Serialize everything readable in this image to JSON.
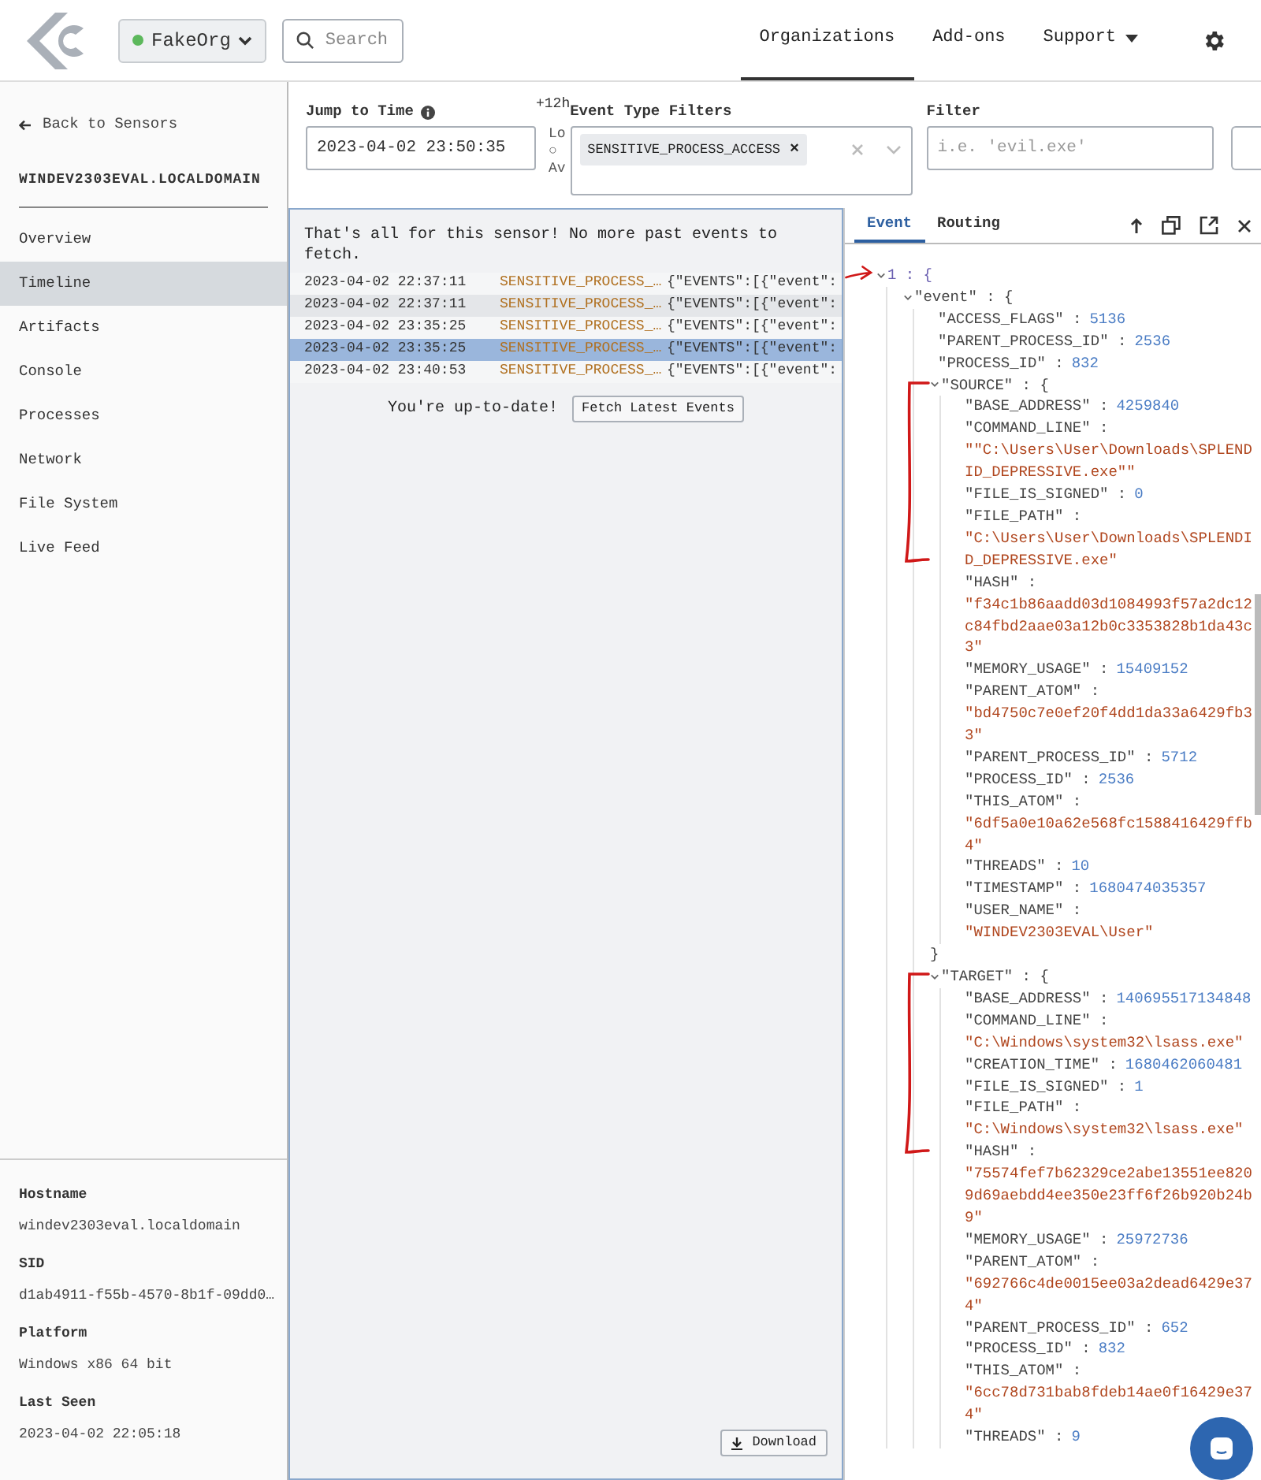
{
  "header": {
    "org": "FakeOrg",
    "search_placeholder": "Search",
    "links": [
      {
        "label": "Organizations",
        "selected": true,
        "dropdown": false
      },
      {
        "label": "Add-ons",
        "selected": false,
        "dropdown": false
      },
      {
        "label": "Support",
        "selected": false,
        "dropdown": true
      }
    ]
  },
  "sidebar": {
    "back": "Back to Sensors",
    "title": "WINDEV2303EVAL.LOCALDOMAIN",
    "items": [
      {
        "label": "Overview",
        "selected": false
      },
      {
        "label": "Timeline",
        "selected": true
      },
      {
        "label": "Artifacts",
        "selected": false
      },
      {
        "label": "Console",
        "selected": false
      },
      {
        "label": "Processes",
        "selected": false
      },
      {
        "label": "Network",
        "selected": false
      },
      {
        "label": "File System",
        "selected": false
      },
      {
        "label": "Live Feed",
        "selected": false
      }
    ],
    "info": [
      {
        "label": "Hostname",
        "value": "windev2303eval.localdomain"
      },
      {
        "label": "SID",
        "value": "d1ab4911-f55b-4570-8b1f-09dd0…"
      },
      {
        "label": "Platform",
        "value": "Windows x86 64 bit"
      },
      {
        "label": "Last Seen",
        "value": "2023-04-02 22:05:18"
      }
    ]
  },
  "filters": {
    "jump_label": "Jump to Time",
    "jump_value": "2023-04-02 23:50:35",
    "offset": "+12h",
    "fragments": [
      "Lo",
      "○",
      "Av"
    ],
    "event_type_label": "Event Type Filters",
    "tags": [
      {
        "label": "SENSITIVE_PROCESS_ACCESS",
        "remove": "×"
      }
    ],
    "filter_label": "Filter",
    "filter_placeholder": "i.e. 'evil.exe'"
  },
  "timeline": {
    "message": "That's all for this sensor! No more past events to fetch.",
    "rows": [
      {
        "time": "2023-04-02 22:37:11",
        "type": "SENSITIVE_PROCESS_…",
        "preview": "{\"EVENTS\":[{\"event\":",
        "selected": false
      },
      {
        "time": "2023-04-02 22:37:11",
        "type": "SENSITIVE_PROCESS_…",
        "preview": "{\"EVENTS\":[{\"event\":",
        "selected": false
      },
      {
        "time": "2023-04-02 23:35:25",
        "type": "SENSITIVE_PROCESS_…",
        "preview": "{\"EVENTS\":[{\"event\":",
        "selected": false
      },
      {
        "time": "2023-04-02 23:35:25",
        "type": "SENSITIVE_PROCESS_…",
        "preview": "{\"EVENTS\":[{\"event\":",
        "selected": true
      },
      {
        "time": "2023-04-02 23:40:53",
        "type": "SENSITIVE_PROCESS_…",
        "preview": "{\"EVENTS\":[{\"event\":",
        "selected": false
      }
    ],
    "status": "You're up-to-date!",
    "fetch_button": "Fetch Latest Events",
    "download": "Download"
  },
  "event_panel": {
    "tabs": [
      {
        "label": "Event",
        "selected": true
      },
      {
        "label": "Routing",
        "selected": false
      }
    ],
    "tree": [
      {
        "key": "1 : {",
        "expanded": true,
        "arrow_mark": true,
        "children": [
          {
            "key": "\"event\" : {",
            "expanded": true,
            "children": [
              {
                "key": "\"ACCESS_FLAGS\" :",
                "value": "5136",
                "kind": "number"
              },
              {
                "key": "\"PARENT_PROCESS_ID\" :",
                "value": "2536",
                "kind": "number"
              },
              {
                "key": "\"PROCESS_ID\" :",
                "value": "832",
                "kind": "number"
              },
              {
                "key": "\"SOURCE\" : {",
                "expanded": true,
                "bracket_mark": true,
                "close": "}",
                "children": [
                  {
                    "key": "\"BASE_ADDRESS\" :",
                    "value": "4259840",
                    "kind": "number"
                  },
                  {
                    "key": "\"COMMAND_LINE\" :",
                    "value": "\"\"C:\\Users\\User\\Downloads\\SPLENDID_DEPRESSIVE.exe\"\"",
                    "kind": "string"
                  },
                  {
                    "key": "\"FILE_IS_SIGNED\" :",
                    "value": "0",
                    "kind": "number"
                  },
                  {
                    "key": "\"FILE_PATH\" :",
                    "value": "\"C:\\Users\\User\\Downloads\\SPLENDID_DEPRESSIVE.exe\"",
                    "kind": "string"
                  },
                  {
                    "key": "\"HASH\" :",
                    "value": "\"f34c1b86aadd03d1084993f57a2dc12c84fbd2aae03a12b0c3353828b1da43c3\"",
                    "kind": "string"
                  },
                  {
                    "key": "\"MEMORY_USAGE\" :",
                    "value": "15409152",
                    "kind": "number"
                  },
                  {
                    "key": "\"PARENT_ATOM\" :",
                    "value": "\"bd4750c7e0ef20f4dd1da33a6429fb33\"",
                    "kind": "string"
                  },
                  {
                    "key": "\"PARENT_PROCESS_ID\" :",
                    "value": "5712",
                    "kind": "number"
                  },
                  {
                    "key": "\"PROCESS_ID\" :",
                    "value": "2536",
                    "kind": "number"
                  },
                  {
                    "key": "\"THIS_ATOM\" :",
                    "value": "\"6df5a0e10a62e568fc1588416429ffb4\"",
                    "kind": "string"
                  },
                  {
                    "key": "\"THREADS\" :",
                    "value": "10",
                    "kind": "number"
                  },
                  {
                    "key": "\"TIMESTAMP\" :",
                    "value": "1680474035357",
                    "kind": "number"
                  },
                  {
                    "key": "\"USER_NAME\" :",
                    "value": "\"WINDEV2303EVAL\\User\"",
                    "kind": "string"
                  }
                ]
              },
              {
                "key": "\"TARGET\" : {",
                "expanded": true,
                "bracket_mark": true,
                "children": [
                  {
                    "key": "\"BASE_ADDRESS\" :",
                    "value": "140695517134848",
                    "kind": "number"
                  },
                  {
                    "key": "\"COMMAND_LINE\" :",
                    "value": "\"C:\\Windows\\system32\\lsass.exe\"",
                    "kind": "string"
                  },
                  {
                    "key": "\"CREATION_TIME\" :",
                    "value": "1680462060481",
                    "kind": "number"
                  },
                  {
                    "key": "\"FILE_IS_SIGNED\" :",
                    "value": "1",
                    "kind": "number"
                  },
                  {
                    "key": "\"FILE_PATH\" :",
                    "value": "\"C:\\Windows\\system32\\lsass.exe\"",
                    "kind": "string"
                  },
                  {
                    "key": "\"HASH\" :",
                    "value": "\"75574fef7b62329ce2abe13551ee8209d69aebdd4ee350e23ff6f26b920b24b9\"",
                    "kind": "string"
                  },
                  {
                    "key": "\"MEMORY_USAGE\" :",
                    "value": "25972736",
                    "kind": "number"
                  },
                  {
                    "key": "\"PARENT_ATOM\" :",
                    "value": "\"692766c4de0015ee03a2dead6429e374\"",
                    "kind": "string"
                  },
                  {
                    "key": "\"PARENT_PROCESS_ID\" :",
                    "value": "652",
                    "kind": "number"
                  },
                  {
                    "key": "\"PROCESS_ID\" :",
                    "value": "832",
                    "kind": "number"
                  },
                  {
                    "key": "\"THIS_ATOM\" :",
                    "value": "\"6cc78d731bab8fdeb14ae0f16429e374\"",
                    "kind": "string"
                  },
                  {
                    "key": "\"THREADS\" :",
                    "value": "9",
                    "kind": "number"
                  }
                ]
              }
            ]
          }
        ]
      }
    ]
  }
}
